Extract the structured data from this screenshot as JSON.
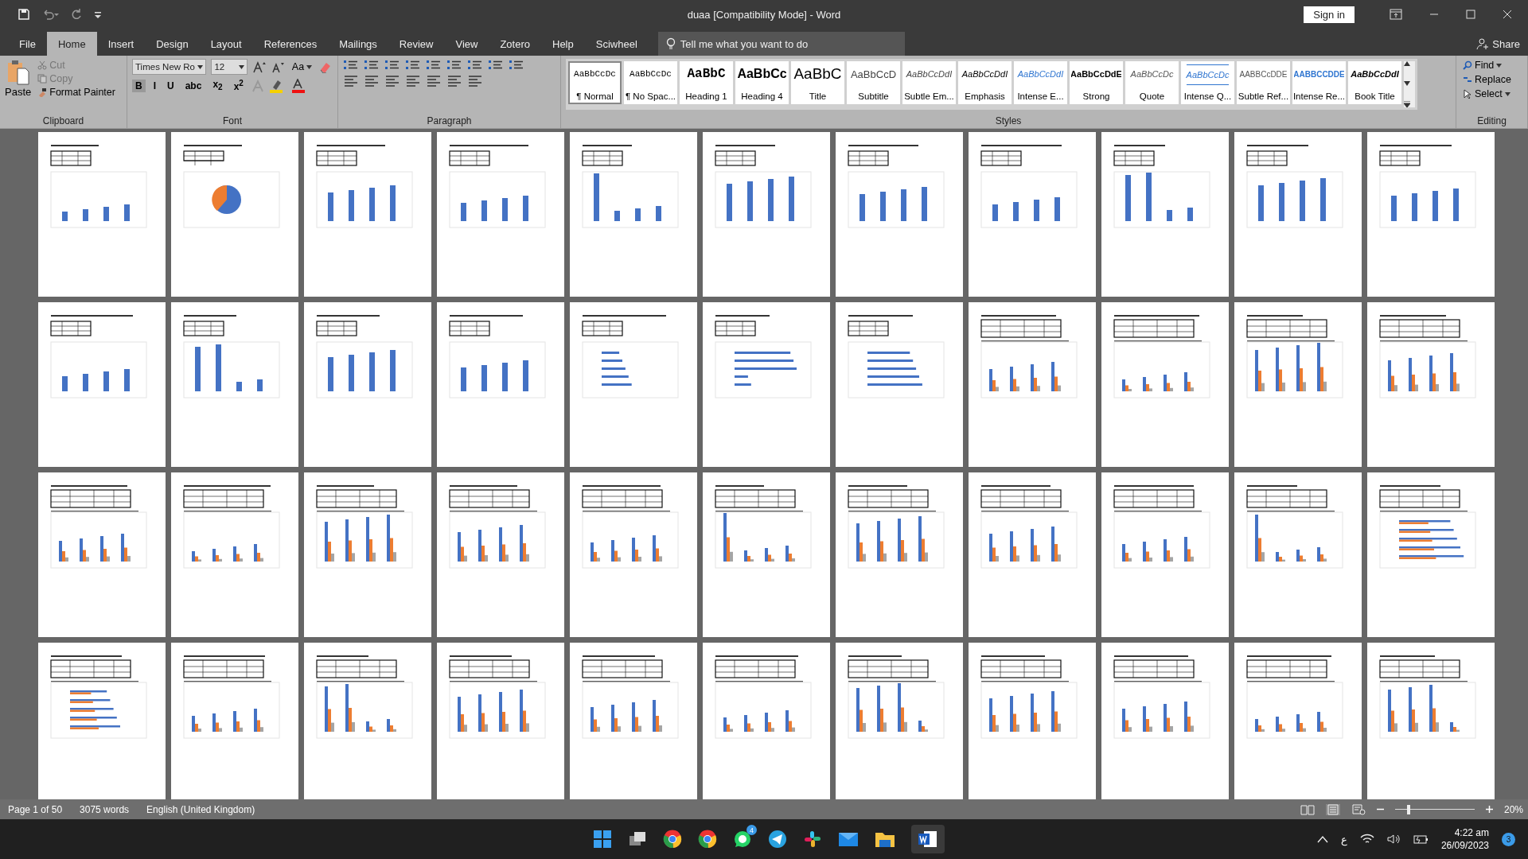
{
  "title_bar": {
    "title": "duaa [Compatibility Mode]  -  Word",
    "sign_in": "Sign in"
  },
  "menu_tabs": [
    {
      "label": "File",
      "selected": false
    },
    {
      "label": "Home",
      "selected": true
    },
    {
      "label": "Insert",
      "selected": false
    },
    {
      "label": "Design",
      "selected": false
    },
    {
      "label": "Layout",
      "selected": false
    },
    {
      "label": "References",
      "selected": false
    },
    {
      "label": "Mailings",
      "selected": false
    },
    {
      "label": "Review",
      "selected": false
    },
    {
      "label": "View",
      "selected": false
    },
    {
      "label": "Zotero",
      "selected": false
    },
    {
      "label": "Help",
      "selected": false
    },
    {
      "label": "Sciwheel",
      "selected": false
    }
  ],
  "tell_me": {
    "placeholder": "Tell me what you want to do"
  },
  "share": "Share",
  "clipboard": {
    "paste": "Paste",
    "cut": {
      "label": "Cut",
      "disabled": true
    },
    "copy": {
      "label": "Copy",
      "disabled": true
    },
    "format_painter": "Format Painter",
    "group_label": "Clipboard"
  },
  "font": {
    "name": "Times New Ro",
    "size": "12",
    "change_case": "Aa",
    "buttons": [
      {
        "label": "B",
        "selected": true
      },
      {
        "label": "I",
        "selected": false
      },
      {
        "label": "U",
        "selected": false
      },
      {
        "label": "abc",
        "selected": false
      },
      {
        "label": "x$_{2}$",
        "selected": false
      },
      {
        "label": "x$^{2}$",
        "selected": false
      }
    ],
    "group_label": "Font"
  },
  "paragraph": {
    "group_label": "Paragraph"
  },
  "styles": {
    "group_label": "Styles",
    "items": [
      {
        "preview": "AaBbCcDc",
        "name": "¶ Normal",
        "kind": "normal",
        "selected": true
      },
      {
        "preview": "AaBbCcDc",
        "name": "¶ No Spac...",
        "kind": "normal",
        "selected": false
      },
      {
        "preview": "AaBbC",
        "name": "Heading 1",
        "kind": "h1",
        "selected": false
      },
      {
        "preview": "AaBbCc",
        "name": "Heading 4",
        "kind": "h4",
        "selected": false
      },
      {
        "preview": "AaBbC",
        "name": "Title",
        "kind": "title",
        "selected": false
      },
      {
        "preview": "AaBbCcD",
        "name": "Subtitle",
        "kind": "subtitle",
        "selected": false
      },
      {
        "preview": "AaBbCcDdI",
        "name": "Subtle Em...",
        "kind": "subtle",
        "selected": false
      },
      {
        "preview": "AaBbCcDdI",
        "name": "Emphasis",
        "kind": "emphasis",
        "selected": false
      },
      {
        "preview": "AaBbCcDdI",
        "name": "Intense E...",
        "kind": "intense",
        "selected": false
      },
      {
        "preview": "AaBbCcDdE",
        "name": "Strong",
        "kind": "strong",
        "selected": false
      },
      {
        "preview": "AaBbCcDc",
        "name": "Quote",
        "kind": "quote",
        "selected": false
      },
      {
        "preview": "AaBbCcDc",
        "name": "Intense Q...",
        "kind": "intense-quote",
        "selected": false
      },
      {
        "preview": "AABBCcDDE",
        "name": "Subtle Ref...",
        "kind": "subtle-ref",
        "selected": false
      },
      {
        "preview": "AABBCCDDE",
        "name": "Intense Re...",
        "kind": "intense-ref",
        "selected": false
      },
      {
        "preview": "AaBbCcDdI",
        "name": "Book Title",
        "kind": "book",
        "selected": false
      }
    ]
  },
  "editing": {
    "find": "Find",
    "replace": "Replace",
    "select": "Select",
    "group_label": "Editing"
  },
  "pages": [
    {
      "kind": "bar"
    },
    {
      "kind": "pie"
    },
    {
      "kind": "bar"
    },
    {
      "kind": "bar"
    },
    {
      "kind": "bar"
    },
    {
      "kind": "bar"
    },
    {
      "kind": "bar"
    },
    {
      "kind": "bar"
    },
    {
      "kind": "bar"
    },
    {
      "kind": "bar"
    },
    {
      "kind": "bar"
    },
    {
      "kind": "bar"
    },
    {
      "kind": "bar"
    },
    {
      "kind": "bar"
    },
    {
      "kind": "bar"
    },
    {
      "kind": "hbar"
    },
    {
      "kind": "hbar"
    },
    {
      "kind": "hbar"
    },
    {
      "kind": "grouped"
    },
    {
      "kind": "grouped"
    },
    {
      "kind": "grouped"
    },
    {
      "kind": "grouped"
    },
    {
      "kind": "grouped"
    },
    {
      "kind": "grouped"
    },
    {
      "kind": "grouped"
    },
    {
      "kind": "grouped"
    },
    {
      "kind": "grouped"
    },
    {
      "kind": "grouped"
    },
    {
      "kind": "grouped"
    },
    {
      "kind": "grouped"
    },
    {
      "kind": "grouped"
    },
    {
      "kind": "grouped"
    },
    {
      "kind": "grouped-hbar"
    },
    {
      "kind": "grouped-hbar"
    },
    {
      "kind": "grouped"
    },
    {
      "kind": "grouped"
    },
    {
      "kind": "grouped"
    },
    {
      "kind": "grouped"
    },
    {
      "kind": "grouped"
    },
    {
      "kind": "grouped"
    },
    {
      "kind": "grouped"
    },
    {
      "kind": "grouped"
    },
    {
      "kind": "grouped"
    },
    {
      "kind": "grouped"
    }
  ],
  "status_bar": {
    "page": "Page 1 of 50",
    "words": "3075 words",
    "language": "English (United Kingdom)",
    "zoom": "20%",
    "zoom_level": {
      "level": 0.15
    }
  },
  "taskbar": {
    "whatsapp_badge": "4",
    "input_language": "ع",
    "time": "4:22 am",
    "date": "26/09/2023",
    "notifications": "3"
  }
}
